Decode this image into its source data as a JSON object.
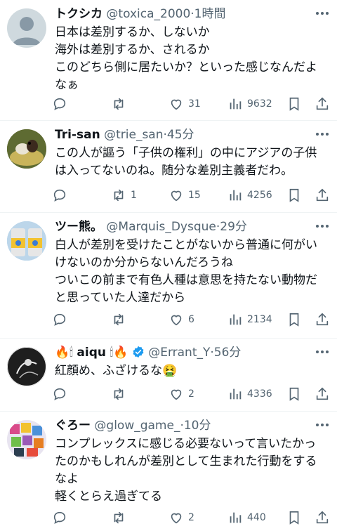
{
  "colors": {
    "text": "#0f1419",
    "muted": "#536471",
    "divider": "#eff3f4",
    "verified": "#1d9bf0"
  },
  "posts": [
    {
      "name": "トクシカ",
      "handle": "@toxica_2000",
      "sep": "·",
      "time": "1時間",
      "lines": [
        "日本は差別するか、しないか",
        "海外は差別するか、されるか",
        "このどちら側に居たいか？といった感じなんだよ",
        "なぁ"
      ],
      "reposts": "",
      "likes": "31",
      "views": "9632"
    },
    {
      "name": "Tri-san",
      "handle": "@trie_san",
      "sep": "·",
      "time": "45分",
      "lines": [
        "この人が謳う「子供の権利」の中にアジアの子供",
        "は入ってないのね。随分な差別主義者だわ。"
      ],
      "reposts": "1",
      "likes": "15",
      "views": "4256"
    },
    {
      "name": "ツー熊。",
      "handle": "@Marquis_Dysque",
      "sep": "·",
      "time": "29分",
      "lines": [
        "白人が差別を受けたことがないから普通に何がい",
        "けないのか分からないんだろうね",
        "ついこの前まで有色人種は意思を持たない動物だ",
        "と思っていた人達だから"
      ],
      "reposts": "",
      "likes": "6",
      "views": "2134"
    },
    {
      "name_pre": "🔥🕯",
      "name": "aiqu",
      "name_post": "🕯🔥",
      "handle": "@Errant_Y",
      "sep": "·",
      "time": "56分",
      "lines": [
        "紅顔め、ふざけるな🤮"
      ],
      "reposts": "",
      "likes": "2",
      "views": "4336"
    },
    {
      "name": "ぐろー",
      "handle": "@glow_game_",
      "sep": "·",
      "time": "10分",
      "lines": [
        "コンプレックスに感じる必要ないって言いたかっ",
        "たのかもしれんが差別として生まれた行動をする",
        "なよ",
        "軽くとらえ過ぎてる"
      ],
      "reposts": "",
      "likes": "2",
      "views": "440"
    }
  ]
}
